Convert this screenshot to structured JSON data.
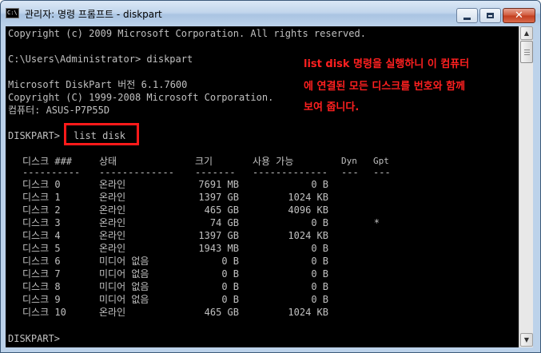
{
  "window": {
    "title": "관리자: 명령 프롬프트 - diskpart",
    "icon_label": "C:\\"
  },
  "console": {
    "lines": [
      "Copyright (c) 2009 Microsoft Corporation. All rights reserved.",
      "",
      "C:\\Users\\Administrator> diskpart",
      "",
      "Microsoft DiskPart 버전 6.1.7600",
      "Copyright (C) 1999-2008 Microsoft Corporation.",
      "컴퓨터: ASUS-P7P55D",
      "",
      "DISKPART> "
    ],
    "command": "list disk",
    "prompt_end": "DISKPART>"
  },
  "table": {
    "headers": [
      "디스크 ###",
      "상태",
      "크기",
      "사용 가능",
      "Dyn",
      "Gpt"
    ],
    "separators": [
      "----------",
      "-------------",
      "-------",
      "-------------",
      "---",
      "---"
    ],
    "rows": [
      [
        "디스크 0",
        "온라인",
        "7691 MB",
        "0 B",
        "",
        ""
      ],
      [
        "디스크 1",
        "온라인",
        "1397 GB",
        "1024 KB",
        "",
        ""
      ],
      [
        "디스크 2",
        "온라인",
        "465 GB",
        "4096 KB",
        "",
        ""
      ],
      [
        "디스크 3",
        "온라인",
        "74 GB",
        "0 B",
        "",
        "*"
      ],
      [
        "디스크 4",
        "온라인",
        "1397 GB",
        "1024 KB",
        "",
        ""
      ],
      [
        "디스크 5",
        "온라인",
        "1943 MB",
        "0 B",
        "",
        ""
      ],
      [
        "디스크 6",
        "미디어 없음",
        "0 B",
        "0 B",
        "",
        ""
      ],
      [
        "디스크 7",
        "미디어 없음",
        "0 B",
        "0 B",
        "",
        ""
      ],
      [
        "디스크 8",
        "미디어 없음",
        "0 B",
        "0 B",
        "",
        ""
      ],
      [
        "디스크 9",
        "미디어 없음",
        "0 B",
        "0 B",
        "",
        ""
      ],
      [
        "디스크 10",
        "온라인",
        "465 GB",
        "1024 KB",
        "",
        ""
      ]
    ]
  },
  "annotation": {
    "lines": [
      "list disk 명령을 실행하니 이 컴퓨터",
      "에 연결된 모든 디스크를 번호와 함께",
      "보여 줍니다."
    ],
    "color": "#ff2020"
  },
  "colors": {
    "console_bg": "#000000",
    "console_text": "#c0c0c0",
    "highlight": "#ff1a1a"
  }
}
